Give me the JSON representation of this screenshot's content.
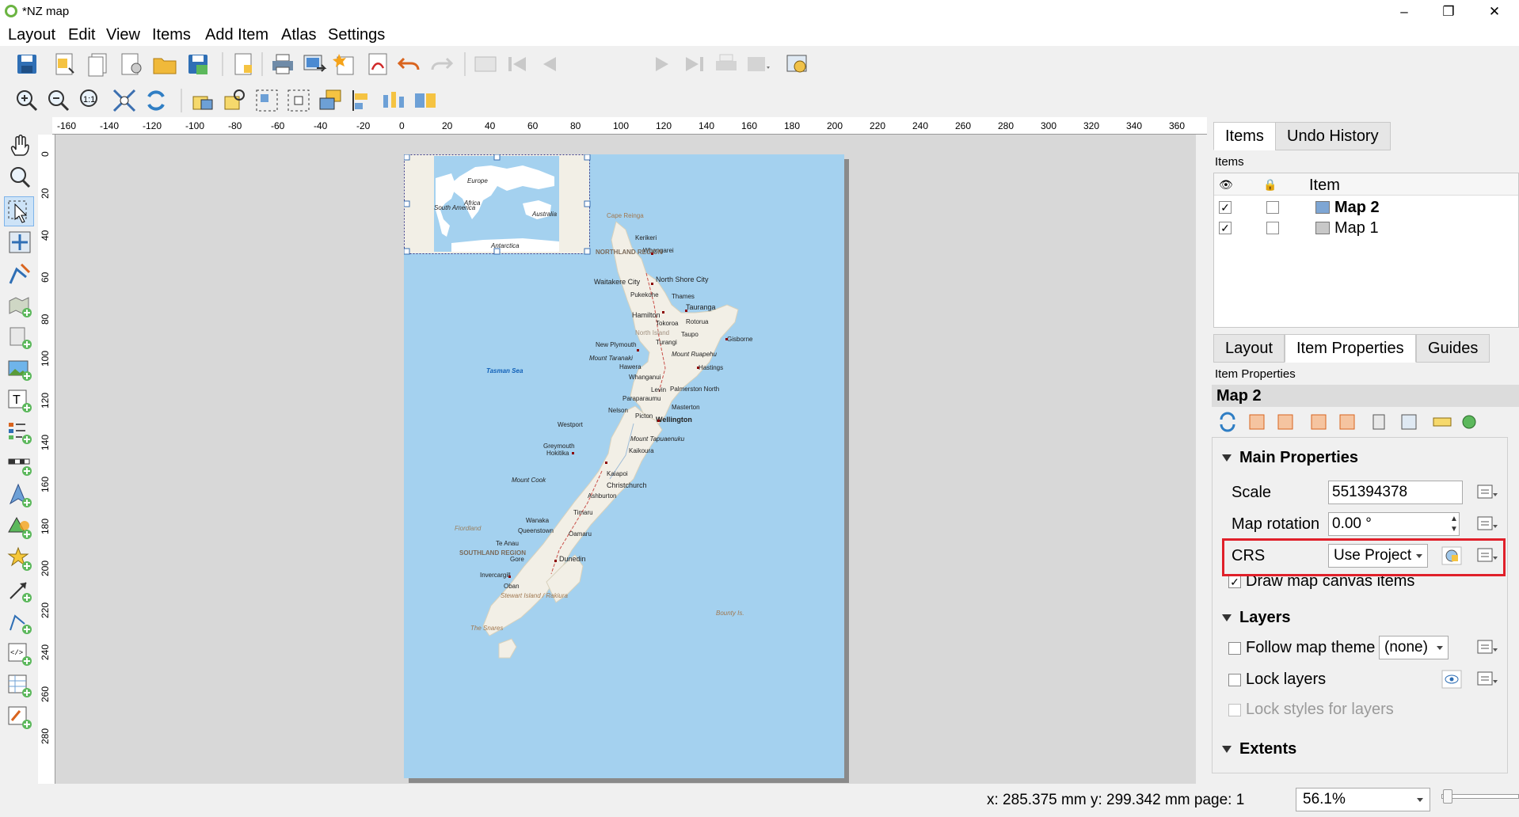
{
  "window": {
    "title": "*NZ map",
    "controls": [
      "–",
      "❐",
      "✕"
    ]
  },
  "menubar": [
    "Layout",
    "Edit",
    "View",
    "Items",
    "Add Item",
    "Atlas",
    "Settings"
  ],
  "toolbar": {
    "page_value": "1"
  },
  "ruler": {
    "h_ticks": [
      "-160",
      "-140",
      "-120",
      "-100",
      "-80",
      "-60",
      "-40",
      "-20",
      "0",
      "20",
      "40",
      "60",
      "80",
      "100",
      "120",
      "140",
      "160",
      "180",
      "200",
      "220",
      "240",
      "260",
      "280",
      "300",
      "320",
      "340",
      "360"
    ],
    "v_ticks": [
      "0",
      "20",
      "40",
      "60",
      "80",
      "100",
      "120",
      "140",
      "160",
      "180",
      "200",
      "220",
      "240",
      "260",
      "280"
    ]
  },
  "map": {
    "inset_labels": [
      "Europe",
      "Africa",
      "South America",
      "Australia",
      "Antarctica"
    ],
    "places": [
      "Cape Reinga",
      "Kerikeri",
      "Whangarei",
      "NORTHLAND REGION",
      "Waitakere City",
      "North Shore City",
      "Pukekohe",
      "Thames",
      "Tauranga",
      "Hamilton",
      "Tokoroa",
      "Rotorua",
      "North Island",
      "Taupo",
      "Gisborne",
      "New Plymouth",
      "Turangi",
      "Mount Ruapehu",
      "Mount Taranaki",
      "Hawera",
      "Hastings",
      "Whanganui",
      "Tasman Sea",
      "Levin",
      "Palmerston North",
      "Paraparaumu",
      "Masterton",
      "Nelson",
      "Picton",
      "Wellington",
      "Westport",
      "Mount Tapuaenuku",
      "Greymouth",
      "Hokitika",
      "Kaikoura",
      "Kaiapoi",
      "Mount Cook",
      "Christchurch",
      "Ashburton",
      "Timaru",
      "Wanaka",
      "Queenstown",
      "Oamaru",
      "Fiordland",
      "Te Anau",
      "SOUTHLAND REGION",
      "Gore",
      "Dunedin",
      "Invercargill",
      "Oban",
      "Stewart Island / Rakiura",
      "The Snares",
      "Bounty Is."
    ]
  },
  "status": {
    "coords": "x: 285.375 mm y: 299.342 mm page: 1",
    "zoom": "56.1%"
  },
  "items_panel": {
    "tabs": [
      "Items",
      "Undo History"
    ],
    "label": "Items",
    "header_item": "Item",
    "rows": [
      {
        "name": "Map 2",
        "visible": true,
        "locked": false,
        "bold": true
      },
      {
        "name": "Map 1",
        "visible": true,
        "locked": false,
        "bold": false
      }
    ]
  },
  "props_panel": {
    "tabs": [
      "Layout",
      "Item Properties",
      "Guides"
    ],
    "label": "Item Properties",
    "item_title": "Map 2",
    "main_section": "Main Properties",
    "scale_label": "Scale",
    "scale_value": "551394378",
    "rotation_label": "Map rotation",
    "rotation_value": "0.00 °",
    "crs_label": "CRS",
    "crs_value": "Use Project",
    "draw_items_label": "Draw map canvas items",
    "draw_items_checked": true,
    "layers_section": "Layers",
    "follow_theme_label": "Follow map theme",
    "follow_theme_value": "(none)",
    "lock_layers_label": "Lock layers",
    "lock_styles_label": "Lock styles for layers",
    "extents_section": "Extents"
  },
  "colors": {
    "sea": "#a4d1ef",
    "land": "#f2efe6",
    "highlight": "#e0202a",
    "road": "#c9504a",
    "city": "#8b0000"
  }
}
